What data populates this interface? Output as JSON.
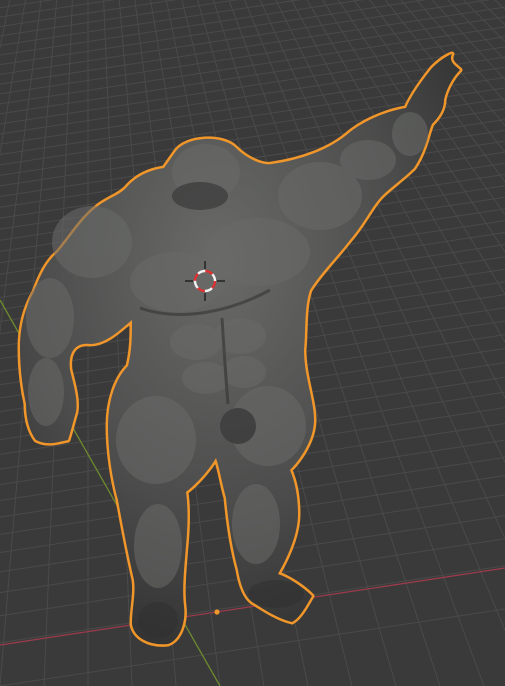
{
  "viewport": {
    "background": "#3a3a3a",
    "grid_color": "#4a4a4a",
    "grid_dark_color": "#333333",
    "x_axis_color": "#9b3b4b",
    "y_axis_color": "#6e8a2e"
  },
  "object": {
    "selection_outline_color": "#f0962a",
    "mesh_base_color": "#4b4c4b",
    "mesh_highlight_color": "#6a6b69",
    "mesh_shadow_color": "#2f302f"
  },
  "cursor": {
    "icon": "3d-cursor-icon",
    "ring_color_a": "#e03030",
    "ring_color_b": "#f2f2f2",
    "crosshair_color": "#111111"
  },
  "origin_point_color": "#f0962a"
}
